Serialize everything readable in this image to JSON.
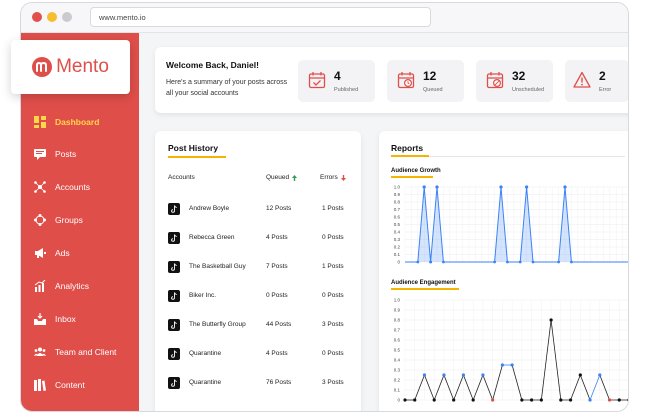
{
  "browser": {
    "url": "www.mento.io"
  },
  "brand": {
    "name": "Mento",
    "color": "#e04e4a"
  },
  "sidebar": {
    "items": [
      {
        "label": "Dashboard",
        "icon": "dashboard-icon",
        "active": true
      },
      {
        "label": "Posts",
        "icon": "posts-icon"
      },
      {
        "label": "Accounts",
        "icon": "accounts-icon"
      },
      {
        "label": "Groups",
        "icon": "groups-icon"
      },
      {
        "label": "Ads",
        "icon": "megaphone-icon"
      },
      {
        "label": "Analytics",
        "icon": "analytics-icon"
      },
      {
        "label": "Inbox",
        "icon": "inbox-icon"
      },
      {
        "label": "Team and Client",
        "icon": "team-icon"
      },
      {
        "label": "Content",
        "icon": "content-icon"
      }
    ]
  },
  "welcome": {
    "title": "Welcome Back, Daniel!",
    "subtitle": "Here's a summary of your posts across all your social accounts"
  },
  "stats": [
    {
      "value": "4",
      "label": "Published",
      "icon": "calendar-check-icon"
    },
    {
      "value": "12",
      "label": "Queued",
      "icon": "calendar-clock-icon"
    },
    {
      "value": "32",
      "label": "Unscheduled",
      "icon": "calendar-cancel-icon"
    },
    {
      "value": "2",
      "label": "Error",
      "icon": "warning-icon"
    }
  ],
  "post_history": {
    "title": "Post History",
    "columns": {
      "accounts": "Accounts",
      "queued": "Queued",
      "errors": "Errors"
    },
    "rows": [
      {
        "account": "Andrew Boyle",
        "queued": "12 Posts",
        "errors": "1 Posts"
      },
      {
        "account": "Rebecca Green",
        "queued": "4 Posts",
        "errors": "0 Posts"
      },
      {
        "account": "The Basketball Guy",
        "queued": "7 Posts",
        "errors": "1 Posts"
      },
      {
        "account": "Biker Inc.",
        "queued": "0 Posts",
        "errors": "0 Posts"
      },
      {
        "account": "The Butterfly Group",
        "queued": "44 Posts",
        "errors": "3 Posts"
      },
      {
        "account": "Quarantine",
        "queued": "4 Posts",
        "errors": "0 Posts"
      },
      {
        "account": "Quarantine",
        "queued": "76 Posts",
        "errors": "3 Posts"
      }
    ]
  },
  "reports": {
    "title": "Reports"
  },
  "chart_data": [
    {
      "type": "area",
      "title": "Audience Growth",
      "ylim": [
        0,
        1.0
      ],
      "yticks": [
        "0",
        "0.1",
        "0.2",
        "0.3",
        "0.4",
        "0.5",
        "0.6",
        "0.7",
        "0.8",
        "0.9",
        "1.0"
      ],
      "grid": true,
      "color": "#3b82f6",
      "values": [
        0,
        0,
        0,
        1,
        0,
        1,
        0,
        0,
        0,
        0,
        0,
        0,
        0,
        0,
        0,
        1,
        0,
        0,
        0,
        1,
        0,
        0,
        0,
        0,
        0,
        1,
        0,
        0,
        0,
        0,
        0,
        0,
        0,
        0,
        0,
        0
      ]
    },
    {
      "type": "line",
      "title": "Audience Engagement",
      "ylim": [
        0,
        1.0
      ],
      "yticks": [
        "0",
        "0.1",
        "0.2",
        "0.3",
        "0.4",
        "0.5",
        "0.6",
        "0.7",
        "0.8",
        "0.9",
        "1.0"
      ],
      "grid": true,
      "values": [
        0,
        0,
        0.25,
        0,
        0.25,
        0,
        0.25,
        0,
        0.25,
        0,
        0.35,
        0.35,
        0,
        0,
        0,
        0.8,
        0,
        0,
        0.25,
        0,
        0.25,
        0,
        0,
        0
      ],
      "highlighted": [
        2,
        4,
        6,
        8,
        10,
        11,
        19,
        20
      ],
      "red_points": [
        9,
        21
      ]
    }
  ]
}
